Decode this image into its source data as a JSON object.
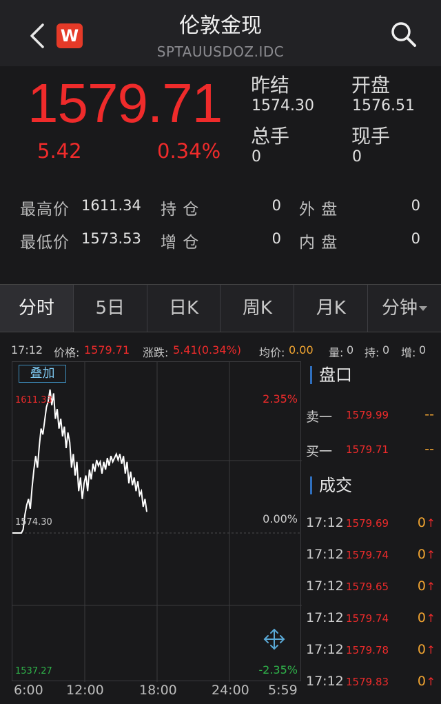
{
  "header": {
    "title": "伦敦金现",
    "code": "SPTAUUSDOZ.IDC",
    "logo_text": "W"
  },
  "quote": {
    "price": "1579.71",
    "change": "5.42",
    "change_pct": "0.34%",
    "prev_close_label": "昨结",
    "prev_close": "1574.30",
    "open_label": "开盘",
    "open": "1576.51",
    "total_vol_label": "总手",
    "total_vol": "0",
    "cur_vol_label": "现手",
    "cur_vol": "0"
  },
  "stats": {
    "high_label": "最高价",
    "high": "1611.34",
    "low_label": "最低价",
    "low": "1573.53",
    "hold_label": "持  仓",
    "hold": "0",
    "inc_label": "增  仓",
    "inc": "0",
    "out_label": "外  盘",
    "out": "0",
    "in_label": "内  盘",
    "in": "0"
  },
  "tabs": [
    "分时",
    "5日",
    "日K",
    "周K",
    "月K",
    "分钟"
  ],
  "infobar": {
    "time": "17:12",
    "price_label": "价格:",
    "price": "1579.71",
    "chg_label": "涨跌:",
    "chg": "5.41(0.34%)",
    "avg_label": "均价:",
    "avg": "0.00",
    "vol_label": "量:",
    "vol": "0",
    "hold_label": "持:",
    "hold": "0",
    "inc_label": "增:",
    "inc": "0"
  },
  "overlay_label": "叠加",
  "chart_data": {
    "type": "line",
    "y_top_label": "1611.33",
    "y_mid_label": "1574.30",
    "y_bottom_label": "1537.27",
    "pct_top": "2.35%",
    "pct_mid": "0.00%",
    "pct_bottom": "-2.35%",
    "x_ticks": [
      "6:00",
      "12:00",
      "18:00",
      "24:00",
      "5:59"
    ],
    "ylim": [
      1537.27,
      1611.33
    ],
    "series": [
      {
        "values": [
          1574.3,
          1574.3,
          1574.3,
          1574.3,
          1574.3,
          1574.3,
          1575.2,
          1579,
          1581.5,
          1583,
          1580.5,
          1586,
          1590.5,
          1594,
          1591,
          1596.5,
          1601,
          1599.5,
          1603,
          1606.5,
          1608,
          1611,
          1607,
          1610,
          1603.5,
          1606,
          1601,
          1603.5,
          1599,
          1601.5,
          1596,
          1600,
          1597.5,
          1591,
          1594.5,
          1589,
          1592.5,
          1585,
          1588.5,
          1583,
          1587,
          1589,
          1585,
          1590.5,
          1588,
          1592,
          1590,
          1593,
          1591.5,
          1592.5,
          1589.5,
          1592.5,
          1590.5,
          1593.5,
          1591.5,
          1594,
          1592.5,
          1593.5,
          1594.5,
          1593,
          1594.5,
          1592,
          1594,
          1589.5,
          1592.5,
          1587,
          1590,
          1586.5,
          1588.5,
          1585,
          1587.5,
          1584,
          1585,
          1581,
          1583,
          1579.7
        ]
      }
    ]
  },
  "side": {
    "book_title": "盘口",
    "sell1_label": "卖一",
    "sell1_price": "1579.99",
    "sell1_vol": "--",
    "buy1_label": "买一",
    "buy1_price": "1579.71",
    "buy1_vol": "--",
    "trades_title": "成交",
    "trades": [
      {
        "time": "17:12",
        "price": "1579.69",
        "vol": "0"
      },
      {
        "time": "17:12",
        "price": "1579.74",
        "vol": "0"
      },
      {
        "time": "17:12",
        "price": "1579.65",
        "vol": "0"
      },
      {
        "time": "17:12",
        "price": "1579.74",
        "vol": "0"
      },
      {
        "time": "17:12",
        "price": "1579.78",
        "vol": "0"
      },
      {
        "time": "17:12",
        "price": "1579.83",
        "vol": "0"
      }
    ]
  },
  "colors": {
    "up": "#ef2b2b",
    "down": "#2fb34a",
    "accent": "#f2a531",
    "line": "#ffffff"
  },
  "icons": {
    "back": "back-arrow-icon",
    "search": "search-icon",
    "expand": "expand-arrows-icon",
    "trade_up": "arrow-up-icon"
  }
}
